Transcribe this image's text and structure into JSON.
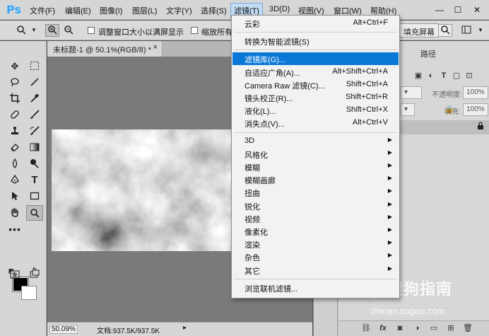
{
  "app": {
    "logo": "Ps"
  },
  "menubar": {
    "items": [
      "文件(F)",
      "编辑(E)",
      "图像(I)",
      "图层(L)",
      "文字(Y)",
      "选择(S)",
      "滤镜(T)",
      "3D(D)",
      "视图(V)",
      "窗口(W)",
      "帮助(H)"
    ],
    "active_index": 6,
    "window_buttons": [
      "—",
      "☐",
      "✕"
    ]
  },
  "options_bar": {
    "resize_windows_label": "调整窗口大小以满屏显示",
    "zoom_all_label": "缩放所有窗",
    "fill_screen_button": "填充屏幕"
  },
  "document": {
    "tab_title": "未标题-1 @ 50.1%(RGB/8) *",
    "close_glyph": "×"
  },
  "status": {
    "zoom": "50.09%",
    "doc_info": "文档:937.5K/937.5K",
    "arrow": "▸"
  },
  "panels": {
    "tab_label": "路径",
    "opacity_label": "不透明度:",
    "opacity_value": "100%",
    "fill_label": "填充:",
    "fill_value": "100%",
    "kind_value": "100%"
  },
  "filter_menu": {
    "items": [
      {
        "label": "云彩",
        "shortcut": "Alt+Ctrl+F",
        "submenu": false,
        "highlighted": false
      },
      {
        "separator": true
      },
      {
        "label": "转换为智能滤镜(S)",
        "shortcut": "",
        "submenu": false,
        "highlighted": false
      },
      {
        "separator": true
      },
      {
        "label": "滤镜库(G)...",
        "shortcut": "",
        "submenu": false,
        "highlighted": true
      },
      {
        "label": "自适应广角(A)...",
        "shortcut": "Alt+Shift+Ctrl+A",
        "submenu": false,
        "highlighted": false
      },
      {
        "label": "Camera Raw 滤镜(C)...",
        "shortcut": "Shift+Ctrl+A",
        "submenu": false,
        "highlighted": false
      },
      {
        "label": "镜头校正(R)...",
        "shortcut": "Shift+Ctrl+R",
        "submenu": false,
        "highlighted": false
      },
      {
        "label": "液化(L)...",
        "shortcut": "Shift+Ctrl+X",
        "submenu": false,
        "highlighted": false
      },
      {
        "label": "消失点(V)...",
        "shortcut": "Alt+Ctrl+V",
        "submenu": false,
        "highlighted": false
      },
      {
        "separator": true
      },
      {
        "label": "3D",
        "shortcut": "",
        "submenu": true,
        "highlighted": false
      },
      {
        "label": "风格化",
        "shortcut": "",
        "submenu": true,
        "highlighted": false
      },
      {
        "label": "模糊",
        "shortcut": "",
        "submenu": true,
        "highlighted": false
      },
      {
        "label": "模糊画廊",
        "shortcut": "",
        "submenu": true,
        "highlighted": false
      },
      {
        "label": "扭曲",
        "shortcut": "",
        "submenu": true,
        "highlighted": false
      },
      {
        "label": "锐化",
        "shortcut": "",
        "submenu": true,
        "highlighted": false
      },
      {
        "label": "视频",
        "shortcut": "",
        "submenu": true,
        "highlighted": false
      },
      {
        "label": "像素化",
        "shortcut": "",
        "submenu": true,
        "highlighted": false
      },
      {
        "label": "渲染",
        "shortcut": "",
        "submenu": true,
        "highlighted": false
      },
      {
        "label": "杂色",
        "shortcut": "",
        "submenu": true,
        "highlighted": false
      },
      {
        "label": "其它",
        "shortcut": "",
        "submenu": true,
        "highlighted": false
      },
      {
        "separator": true
      },
      {
        "label": "浏览联机滤镜...",
        "shortcut": "",
        "submenu": false,
        "highlighted": false
      }
    ]
  },
  "watermark": {
    "brand": "搜狗指南",
    "url": "zhinan.sogou.com"
  },
  "colors": {
    "accent": "#31a8ff",
    "menu_highlight": "#0a78d7",
    "workspace": "#535353"
  }
}
